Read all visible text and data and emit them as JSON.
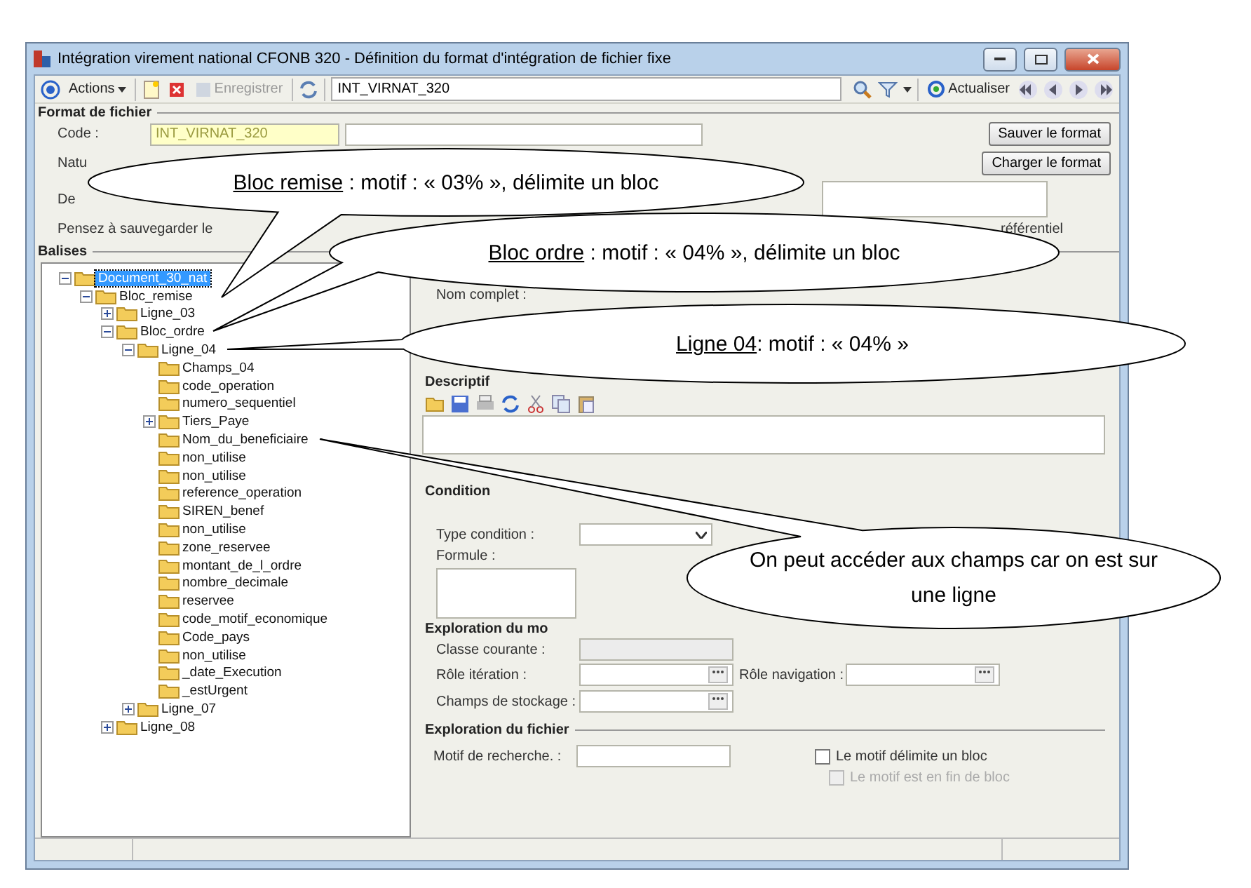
{
  "window": {
    "title": "Intégration virement national CFONB 320 -  Définition du format d'intégration de fichier fixe"
  },
  "toolbar": {
    "actions": "Actions",
    "save": {
      "label": "Enregistrer",
      "disabled": true
    },
    "search": {
      "value": "INT_VIRNAT_320"
    },
    "refresh": "Actualiser"
  },
  "format": {
    "title": "Format de fichier",
    "code_label": "Code :",
    "code_value": "INT_VIRNAT_320",
    "nature_label": "Natu",
    "desc_label": "De",
    "hint": "Pensez à sauvegarder le",
    "hint_right": "référentiel",
    "buttons": [
      "Sauver le format",
      "Charger le format"
    ]
  },
  "tree": {
    "title": "Balises",
    "items": [
      {
        "label": "Document_30_nat",
        "selected": true,
        "expanded": true,
        "children": [
          {
            "label": "Bloc_remise",
            "selected": false,
            "expanded": true,
            "children": [
              {
                "label": "Ligne_03",
                "selected": false,
                "expanded": false
              },
              {
                "label": "Bloc_ordre",
                "selected": false,
                "expanded": true,
                "children": [
                  {
                    "label": "Ligne_04",
                    "selected": false,
                    "expanded": true,
                    "children": [
                      {
                        "label": "Champs_04",
                        "selected": false
                      },
                      {
                        "label": "code_operation",
                        "selected": false
                      },
                      {
                        "label": "numero_sequentiel",
                        "selected": false
                      },
                      {
                        "label": "Tiers_Paye",
                        "selected": false,
                        "expanded": false
                      },
                      {
                        "label": "Nom_du_beneficiaire",
                        "selected": false
                      },
                      {
                        "label": "non_utilise",
                        "selected": false
                      },
                      {
                        "label": "non_utilise",
                        "selected": false
                      },
                      {
                        "label": "reference_operation",
                        "selected": false
                      },
                      {
                        "label": "SIREN_benef",
                        "selected": false
                      },
                      {
                        "label": "non_utilise",
                        "selected": false
                      },
                      {
                        "label": "zone_reservee",
                        "selected": false
                      },
                      {
                        "label": "montant_de_l_ordre",
                        "selected": false
                      },
                      {
                        "label": "nombre_decimale",
                        "selected": false
                      },
                      {
                        "label": "reservee",
                        "selected": false
                      },
                      {
                        "label": "code_motif_economique",
                        "selected": false
                      },
                      {
                        "label": "Code_pays",
                        "selected": false
                      },
                      {
                        "label": "non_utilise",
                        "selected": false
                      },
                      {
                        "label": "_date_Execution",
                        "selected": false
                      },
                      {
                        "label": "_estUrgent",
                        "selected": false
                      }
                    ]
                  },
                  {
                    "label": "Ligne_07",
                    "selected": false,
                    "expanded": false
                  }
                ]
              },
              {
                "label": "Ligne_08",
                "selected": false,
                "expanded": false
              }
            ]
          }
        ]
      }
    ]
  },
  "details": {
    "name_label": "Nom complet :",
    "description_title": "Descriptif",
    "condition": {
      "title": "Condition",
      "type_label": "Type condition :",
      "formula_label": "Formule :"
    },
    "model": {
      "title": "Exploration du mo",
      "class_label": "Classe courante :",
      "iteration_label": "Rôle itération :",
      "navigation_label": "Rôle navigation :",
      "storage_label": "Champs de stockage :"
    },
    "file": {
      "title": "Exploration du fichier",
      "motif_label": "Motif de recherche. :",
      "options": [
        {
          "label": "Le motif délimite un bloc",
          "checked": false,
          "disabled": false
        },
        {
          "label": "Le motif est en fin de bloc",
          "checked": false,
          "disabled": true
        }
      ]
    }
  },
  "callouts": [
    {
      "label": "Bloc remise",
      "text": " : motif : « 03% », délimite un bloc"
    },
    {
      "label": "Bloc ordre",
      "text": " : motif : « 04% », délimite un bloc"
    },
    {
      "label": "Ligne 04",
      "text": ": motif : « 04% »"
    },
    {
      "text": "On peut accéder aux champs car on est sur une ligne"
    }
  ]
}
